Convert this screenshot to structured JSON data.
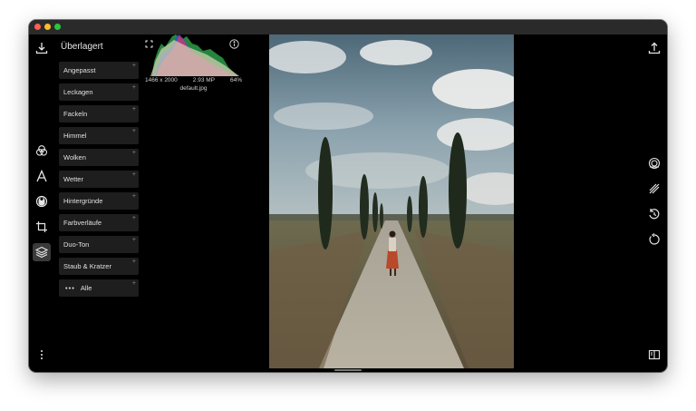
{
  "window": {
    "accent": "#3a3a3a"
  },
  "panel": {
    "title": "Überlagert",
    "filters": [
      {
        "label": "Angepasst"
      },
      {
        "label": "Leckagen"
      },
      {
        "label": "Fackeln"
      },
      {
        "label": "Himmel"
      },
      {
        "label": "Wolken"
      },
      {
        "label": "Wetter"
      },
      {
        "label": "Hintergründe"
      },
      {
        "label": "Farbverläufe"
      },
      {
        "label": "Duo-Ton"
      },
      {
        "label": "Staub & Kratzer"
      }
    ],
    "more_label": "Alle",
    "plus_glyph": "+"
  },
  "histogram": {
    "dimensions": "1466 x 2000",
    "megapixels": "2.93 MP",
    "zoom": "64%",
    "filename": "default.jpg"
  },
  "icons": {
    "left_rail": [
      "download-icon",
      "filters-icon",
      "text-icon",
      "mask-icon",
      "crop-icon",
      "layers-icon",
      "more-icon"
    ],
    "right_rail": [
      "share-icon",
      "compare-icon",
      "split-icon",
      "undo-history-icon",
      "undo-icon",
      "sidebar-toggle-icon"
    ]
  }
}
